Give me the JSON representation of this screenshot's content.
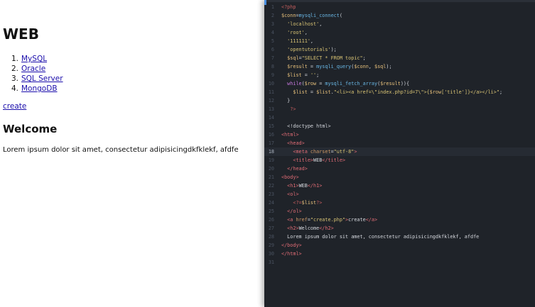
{
  "page": {
    "title": "WEB",
    "topics": [
      {
        "num": "1.",
        "label": "MySQL"
      },
      {
        "num": "2.",
        "label": "Oracle"
      },
      {
        "num": "3.",
        "label": "SQL Server"
      },
      {
        "num": "4.",
        "label": "MongoDB"
      }
    ],
    "create_link": "create",
    "welcome_heading": "Welcome",
    "body_text": "Lorem ipsum dolor sit amet, consectetur adipisicingdkfklekf, afdfe"
  },
  "editor": {
    "active_line": 18,
    "lines": [
      [
        {
          "c": "t-php",
          "t": "<?php"
        }
      ],
      [
        {
          "c": "t-var",
          "t": "$conn"
        },
        {
          "c": "t-plain",
          "t": "="
        },
        {
          "c": "t-fn",
          "t": "mysqli_connect"
        },
        {
          "c": "t-plain",
          "t": "("
        }
      ],
      [
        {
          "c": "t-str",
          "t": "  'localhost'"
        },
        {
          "c": "t-plain",
          "t": ","
        }
      ],
      [
        {
          "c": "t-str",
          "t": "  'root'"
        },
        {
          "c": "t-plain",
          "t": ","
        }
      ],
      [
        {
          "c": "t-str",
          "t": "  '111111'"
        },
        {
          "c": "t-plain",
          "t": ","
        }
      ],
      [
        {
          "c": "t-str",
          "t": "  'opentutorials'"
        },
        {
          "c": "t-plain",
          "t": ");"
        }
      ],
      [
        {
          "c": "t-var",
          "t": "  $sql"
        },
        {
          "c": "t-plain",
          "t": "="
        },
        {
          "c": "t-str",
          "t": "\"SELECT * FROM topic\""
        },
        {
          "c": "t-plain",
          "t": ";"
        }
      ],
      [
        {
          "c": "t-var",
          "t": "  $result"
        },
        {
          "c": "t-plain",
          "t": " = "
        },
        {
          "c": "t-fn",
          "t": "mysqli_query"
        },
        {
          "c": "t-plain",
          "t": "("
        },
        {
          "c": "t-var",
          "t": "$conn"
        },
        {
          "c": "t-plain",
          "t": ", "
        },
        {
          "c": "t-var",
          "t": "$sql"
        },
        {
          "c": "t-plain",
          "t": ");"
        }
      ],
      [
        {
          "c": "t-var",
          "t": "  $list"
        },
        {
          "c": "t-plain",
          "t": " = "
        },
        {
          "c": "t-str",
          "t": "''"
        },
        {
          "c": "t-plain",
          "t": ";"
        }
      ],
      [
        {
          "c": "t-kw",
          "t": "  while"
        },
        {
          "c": "t-plain",
          "t": "("
        },
        {
          "c": "t-var",
          "t": "$row"
        },
        {
          "c": "t-plain",
          "t": " = "
        },
        {
          "c": "t-fn",
          "t": "mysqli_fetch_array"
        },
        {
          "c": "t-plain",
          "t": "("
        },
        {
          "c": "t-var",
          "t": "$result"
        },
        {
          "c": "t-plain",
          "t": ")){"
        }
      ],
      [
        {
          "c": "t-var",
          "t": "    $list"
        },
        {
          "c": "t-plain",
          "t": " = "
        },
        {
          "c": "t-var",
          "t": "$list"
        },
        {
          "c": "t-plain",
          "t": "."
        },
        {
          "c": "t-str",
          "t": "\"<li><a href=\\\"index.php?id=7\\\">{"
        },
        {
          "c": "t-var",
          "t": "$row"
        },
        {
          "c": "t-str",
          "t": "['title']}</a></li>\""
        },
        {
          "c": "t-plain",
          "t": ";"
        }
      ],
      [
        {
          "c": "t-plain",
          "t": "  }"
        }
      ],
      [
        {
          "c": "t-php",
          "t": "   ?>"
        }
      ],
      [
        {
          "c": "t-plain",
          "t": ""
        }
      ],
      [
        {
          "c": "t-plain",
          "t": "  <!doctype html>"
        }
      ],
      [
        {
          "c": "t-tag",
          "t": "<html>"
        }
      ],
      [
        {
          "c": "t-tag",
          "t": "  <head>"
        }
      ],
      [
        {
          "c": "t-tag",
          "t": "    <meta "
        },
        {
          "c": "t-attr",
          "t": "charset"
        },
        {
          "c": "t-plain",
          "t": "="
        },
        {
          "c": "t-str",
          "t": "\"utf-8\""
        },
        {
          "c": "t-tag",
          "t": ">"
        }
      ],
      [
        {
          "c": "t-tag",
          "t": "    <title>"
        },
        {
          "c": "t-plain",
          "t": "WEB"
        },
        {
          "c": "t-tag",
          "t": "</title>"
        }
      ],
      [
        {
          "c": "t-tag",
          "t": "  </head>"
        }
      ],
      [
        {
          "c": "t-tag",
          "t": "<body>"
        }
      ],
      [
        {
          "c": "t-tag",
          "t": "  <h1>"
        },
        {
          "c": "t-plain",
          "t": "WEB"
        },
        {
          "c": "t-tag",
          "t": "</h1>"
        }
      ],
      [
        {
          "c": "t-tag",
          "t": "  <ol>"
        }
      ],
      [
        {
          "c": "t-php",
          "t": "    <?="
        },
        {
          "c": "t-var",
          "t": "$list"
        },
        {
          "c": "t-php",
          "t": "?>"
        }
      ],
      [
        {
          "c": "t-tag",
          "t": "  </ol>"
        }
      ],
      [
        {
          "c": "t-tag",
          "t": "  <a "
        },
        {
          "c": "t-attr",
          "t": "href"
        },
        {
          "c": "t-plain",
          "t": "="
        },
        {
          "c": "t-str",
          "t": "\"create.php\""
        },
        {
          "c": "t-tag",
          "t": ">"
        },
        {
          "c": "t-plain",
          "t": "create"
        },
        {
          "c": "t-tag",
          "t": "</a>"
        }
      ],
      [
        {
          "c": "t-tag",
          "t": "  <h2>"
        },
        {
          "c": "t-plain",
          "t": "Welcome"
        },
        {
          "c": "t-tag",
          "t": "</h2>"
        }
      ],
      [
        {
          "c": "t-plain",
          "t": "  Lorem ipsum dolor sit amet, consectetur adipisicingdkfklekf, afdfe"
        }
      ],
      [
        {
          "c": "t-tag",
          "t": "</body>"
        }
      ],
      [
        {
          "c": "t-tag",
          "t": "</html>"
        }
      ],
      [
        {
          "c": "t-plain",
          "t": ""
        }
      ]
    ]
  }
}
